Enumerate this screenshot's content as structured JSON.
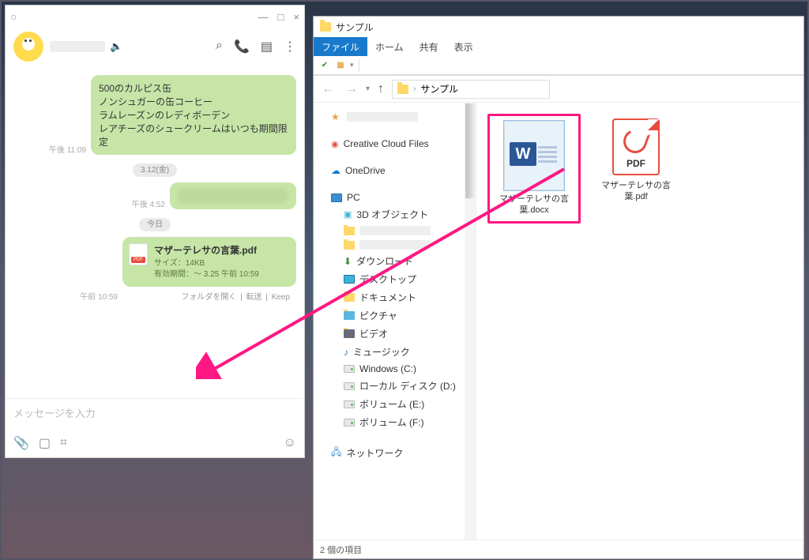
{
  "chat": {
    "titlebar": {
      "min": "—",
      "max": "□",
      "close": "×",
      "handle": "○"
    },
    "header": {
      "speaker_icon": "🔈",
      "search_icon": "⌕",
      "call_icon": "📞",
      "note_icon": "▤",
      "more_icon": "⋮"
    },
    "messages": {
      "msg1_lines": [
        "500のカルピス缶",
        "ノンシュガーの缶コーヒー",
        "ラムレーズンのレディボーデン",
        "レアチーズのシュークリームはいつも期間限定"
      ],
      "msg1_time": "午後 11:09",
      "date1": "3.12(金)",
      "msg2_time": "午後 4:52",
      "date2": "今日",
      "file_title": "マザーテレサの言葉.pdf",
      "file_size": "サイズ：14KB",
      "file_expire": "有効期間：～ 3.25 午前 10:59",
      "file_time": "午前 10:59",
      "file_actions": {
        "open": "フォルダを開く",
        "fwd": "転送",
        "keep": "Keep"
      }
    },
    "input_placeholder": "メッセージを入力",
    "footer": {
      "attach": "📎",
      "bookmark": "🔖",
      "crop": "�և�",
      "smile": "☺"
    }
  },
  "explorer": {
    "title": "サンプル",
    "ribbon_tabs": {
      "file": "ファイル",
      "home": "ホーム",
      "share": "共有",
      "view": "表示"
    },
    "breadcrumb": {
      "root": "サンプル",
      "sep": "›"
    },
    "nav": {
      "back": "←",
      "fwd": "→",
      "up": "↑"
    },
    "tree": {
      "creative": "Creative Cloud Files",
      "onedrive": "OneDrive",
      "pc": "PC",
      "obj3d": "3D オブジェクト",
      "downloads": "ダウンロード",
      "desktop": "デスクトップ",
      "documents": "ドキュメント",
      "pictures": "ピクチャ",
      "videos": "ビデオ",
      "music": "ミュージック",
      "win_c": "Windows (C:)",
      "local_d": "ローカル ディスク (D:)",
      "vol_e": "ボリューム (E:)",
      "vol_f": "ボリューム (F:)",
      "network": "ネットワーク"
    },
    "files": {
      "word_name": "マザーテレサの言葉.docx",
      "pdf_name": "マザーテレサの言葉.pdf",
      "pdf_label": "PDF",
      "word_letter": "W"
    },
    "status": "2 個の項目"
  }
}
